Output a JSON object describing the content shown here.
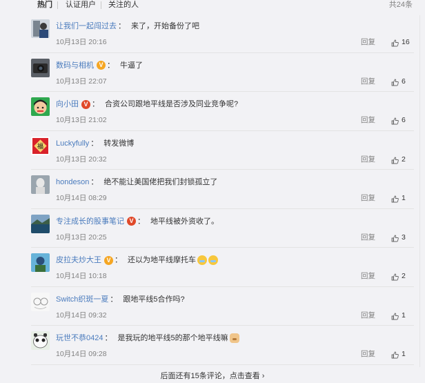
{
  "tabs": [
    {
      "label": "热门"
    },
    {
      "label": "认证用户"
    },
    {
      "label": "关注的人"
    }
  ],
  "total": "共24条",
  "reply_label": "回复",
  "comments": [
    {
      "user": "让我们一起闯过去",
      "text": "来了，开始备份了吧",
      "time": "10月13日 20:16",
      "likes": "16",
      "badge": ""
    },
    {
      "user": "数码与相机",
      "text": "牛逼了",
      "time": "10月13日 22:07",
      "likes": "6",
      "badge": "gold"
    },
    {
      "user": "向小田",
      "text": "合资公司跟地平线是否涉及同业竞争呢?",
      "time": "10月13日 21:02",
      "likes": "6",
      "badge": "red"
    },
    {
      "user": "Luckyfully",
      "text": "转发微博",
      "time": "10月13日 20:32",
      "likes": "2",
      "badge": ""
    },
    {
      "user": "hondeson",
      "text": "绝不能让美国佬把我们封锁孤立了",
      "time": "10月14日 08:29",
      "likes": "1",
      "badge": ""
    },
    {
      "user": "专注成长的股事笔记",
      "text": "地平线被外资收了。",
      "time": "10月13日 20:25",
      "likes": "3",
      "badge": "red"
    },
    {
      "user": "皮拉夫炒大王",
      "text": "还以为地平线摩托车",
      "time": "10月14日 10:18",
      "likes": "2",
      "badge": "gold"
    },
    {
      "user": "Switch织斑一夏",
      "text": "跟地平线5合作吗?",
      "time": "10月14日 09:32",
      "likes": "1",
      "badge": ""
    },
    {
      "user": "玩世不恭0424",
      "text": "是我玩的地平线5的那个地平线嘛",
      "time": "10月14日 09:28",
      "likes": "1",
      "badge": ""
    }
  ],
  "more_text": "后面还有15条评论，点击查看 ›",
  "colors": {
    "link": "#4a7bbd",
    "gold": "#f5a623",
    "red": "#e0492a"
  }
}
